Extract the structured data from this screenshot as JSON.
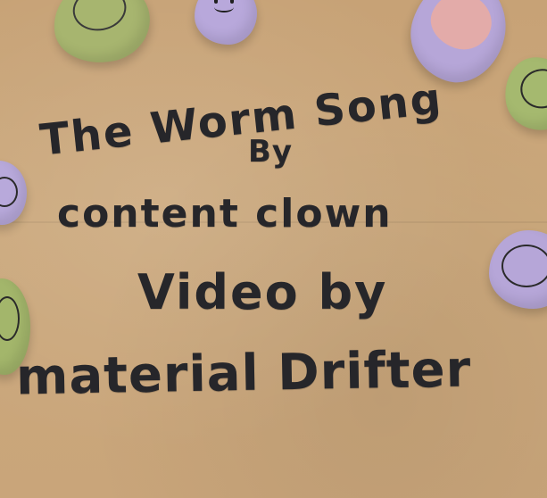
{
  "sign": {
    "line1": "The Worm Song",
    "line2": "By",
    "line3": "content clown",
    "line4": "Video by",
    "line5": "material Drifter"
  },
  "colors": {
    "paper": "#c9a57a",
    "letters": "#26262a",
    "toy_green": "#a6b56d",
    "toy_lavender": "#b6a6d8",
    "toy_pink": "#e2aaa8"
  }
}
